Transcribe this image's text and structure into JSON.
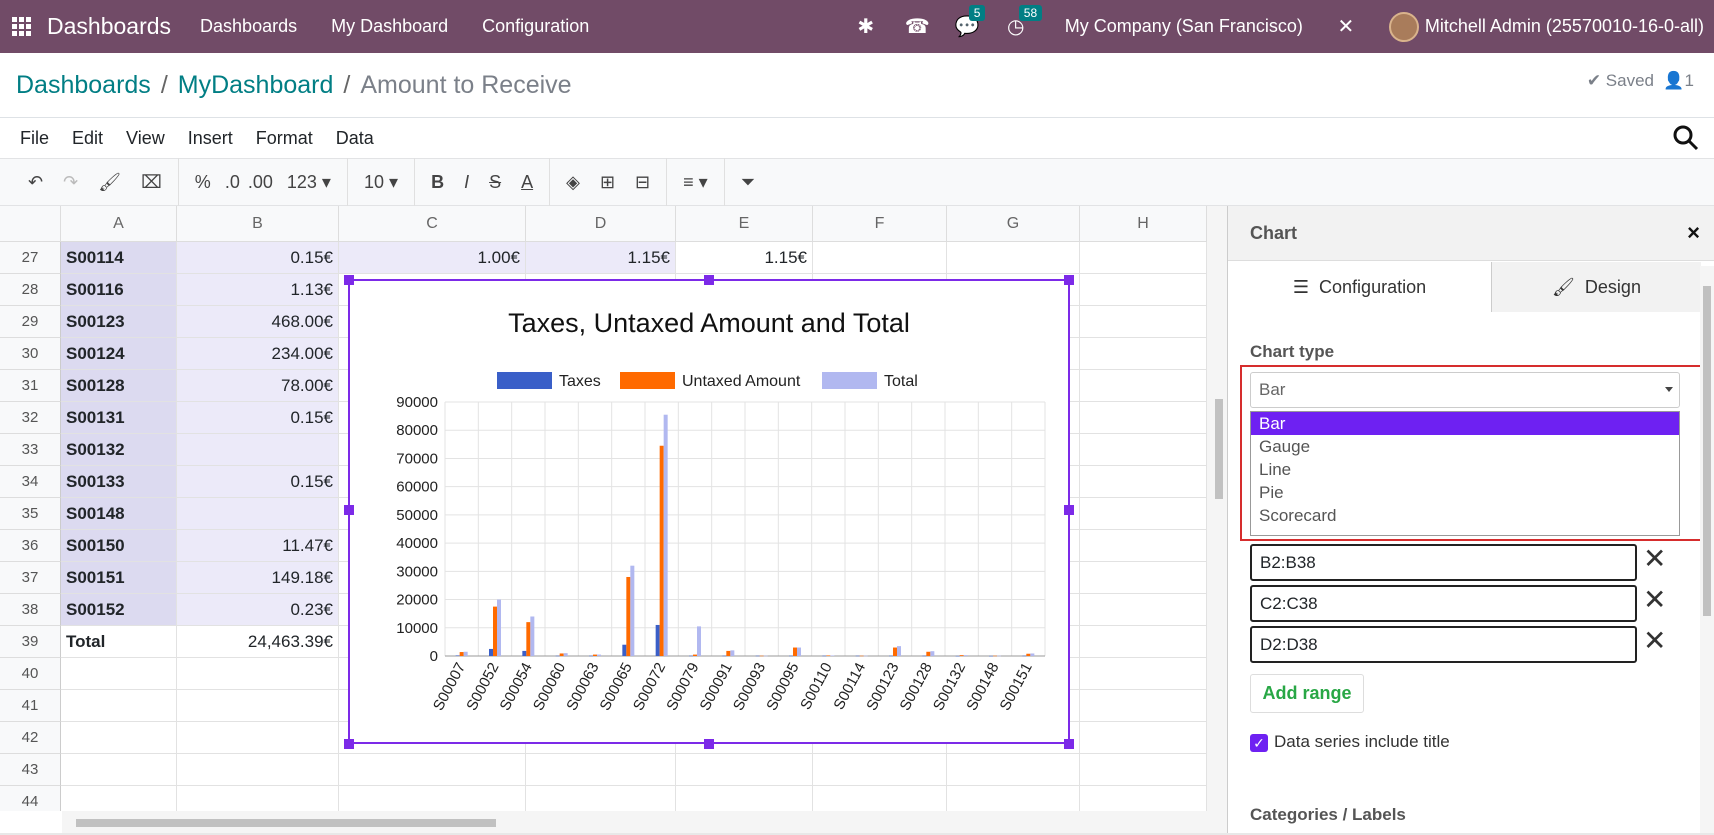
{
  "topbar": {
    "app_name": "Dashboards",
    "nav": [
      "Dashboards",
      "My Dashboard",
      "Configuration"
    ],
    "messages_count": "5",
    "activity_count": "58",
    "company": "My Company (San Francisco)",
    "user": "Mitchell Admin (25570010-16-0-all)"
  },
  "breadcrumb": {
    "items": [
      "Dashboards",
      "MyDashboard"
    ],
    "current": "Amount to Receive",
    "saved": "Saved",
    "users": "1"
  },
  "menu": [
    "File",
    "Edit",
    "View",
    "Insert",
    "Format",
    "Data"
  ],
  "toolbar": {
    "percent": "%",
    "dec1": ".0",
    "dec2": ".00",
    "numfmt": "123",
    "font_size": "10"
  },
  "sheet": {
    "columns": [
      "A",
      "B",
      "C",
      "D",
      "E",
      "F",
      "G",
      "H"
    ],
    "rows": [
      {
        "n": "27",
        "a": "S00114",
        "b": "0.15€",
        "c": "1.00€",
        "d": "1.15€",
        "e": "1.15€"
      },
      {
        "n": "28",
        "a": "S00116",
        "b": "1.13€"
      },
      {
        "n": "29",
        "a": "S00123",
        "b": "468.00€"
      },
      {
        "n": "30",
        "a": "S00124",
        "b": "234.00€"
      },
      {
        "n": "31",
        "a": "S00128",
        "b": "78.00€"
      },
      {
        "n": "32",
        "a": "S00131",
        "b": "0.15€"
      },
      {
        "n": "33",
        "a": "S00132",
        "b": ""
      },
      {
        "n": "34",
        "a": "S00133",
        "b": "0.15€"
      },
      {
        "n": "35",
        "a": "S00148",
        "b": ""
      },
      {
        "n": "36",
        "a": "S00150",
        "b": "11.47€"
      },
      {
        "n": "37",
        "a": "S00151",
        "b": "149.18€"
      },
      {
        "n": "38",
        "a": "S00152",
        "b": "0.23€"
      },
      {
        "n": "39",
        "a": "Total",
        "b": "24,463.39€"
      },
      {
        "n": "40",
        "a": "",
        "b": ""
      },
      {
        "n": "41",
        "a": "",
        "b": ""
      },
      {
        "n": "42",
        "a": "",
        "b": ""
      },
      {
        "n": "43",
        "a": "",
        "b": ""
      },
      {
        "n": "44",
        "a": "",
        "b": ""
      }
    ]
  },
  "chart_data": {
    "type": "bar",
    "title": "Taxes, Untaxed Amount and Total",
    "legend_position": "top",
    "ylim": [
      0,
      90000
    ],
    "yticks": [
      "90000",
      "80000",
      "70000",
      "60000",
      "50000",
      "40000",
      "30000",
      "20000",
      "10000",
      "0"
    ],
    "colors": [
      "#3a5fc8",
      "#ff6a00",
      "#b1b8f0"
    ],
    "categories": [
      "S00007",
      "S00052",
      "S00054",
      "S00060",
      "S00063",
      "S00065",
      "S00072",
      "S00079",
      "S00091",
      "S00093",
      "S00095",
      "S00110",
      "S00114",
      "S00123",
      "S00128",
      "S00132",
      "S00148",
      "S00151"
    ],
    "series": [
      {
        "name": "Taxes",
        "values": [
          200,
          2500,
          1800,
          100,
          100,
          4000,
          11000,
          100,
          100,
          100,
          100,
          100,
          100,
          100,
          100,
          50,
          50,
          100
        ]
      },
      {
        "name": "Untaxed Amount",
        "values": [
          1400,
          17500,
          12000,
          900,
          500,
          28000,
          74500,
          500,
          1800,
          100,
          3000,
          200,
          100,
          3000,
          1500,
          300,
          100,
          800
        ]
      },
      {
        "name": "Total",
        "values": [
          1500,
          20000,
          14000,
          1000,
          500,
          32000,
          85500,
          10500,
          2000,
          100,
          3000,
          200,
          100,
          3500,
          1700,
          300,
          100,
          900
        ]
      }
    ]
  },
  "panel": {
    "title": "Chart",
    "tabs": [
      "Configuration",
      "Design"
    ],
    "chart_type_label": "Chart type",
    "selected": "Bar",
    "options": [
      "Bar",
      "Gauge",
      "Line",
      "Pie",
      "Scorecard"
    ],
    "ranges": [
      "B2:B38",
      "C2:C38",
      "D2:D38"
    ],
    "add_range": "Add range",
    "checkbox_label": "Data series include title",
    "categories_label": "Categories / Labels"
  }
}
